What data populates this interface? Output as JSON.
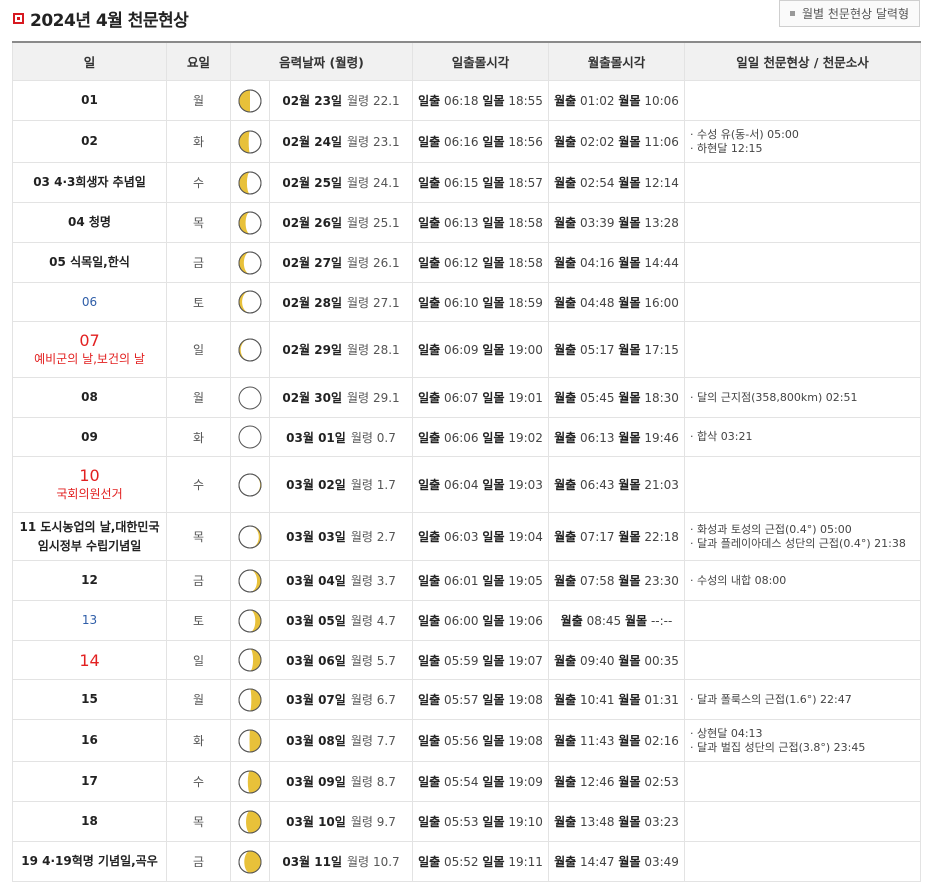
{
  "header": {
    "title": "2024년 4월 천문현상",
    "calendar_button": "월별 천문현상 달력형"
  },
  "columns": [
    "일",
    "요일",
    "음력날짜 (월령)",
    "일출몰시각",
    "월출몰시각",
    "일일 천문현상 / 천문소사"
  ],
  "labels": {
    "sunrise": "일출",
    "sunset": "일몰",
    "moonrise": "월출",
    "moonset": "월몰",
    "age": "월령"
  },
  "rows": [
    {
      "day": "01",
      "holiday": "",
      "style": "normal",
      "dow": "월",
      "lunar": "02월 23일",
      "age": "22.1",
      "sunrise": "06:18",
      "sunset": "18:55",
      "moonrise": "01:02",
      "moonset": "10:06",
      "events": [],
      "phase": 0.75
    },
    {
      "day": "02",
      "holiday": "",
      "style": "normal",
      "dow": "화",
      "lunar": "02월 24일",
      "age": "23.1",
      "sunrise": "06:16",
      "sunset": "18:56",
      "moonrise": "02:02",
      "moonset": "11:06",
      "events": [
        "수성 유(동-서) 05:00",
        "하현달 12:15"
      ],
      "phase": 0.78
    },
    {
      "day": "03",
      "holiday": "4·3희생자 추념일",
      "style": "inline",
      "dow": "수",
      "lunar": "02월 25일",
      "age": "24.1",
      "sunrise": "06:15",
      "sunset": "18:57",
      "moonrise": "02:54",
      "moonset": "12:14",
      "events": [],
      "phase": 0.82
    },
    {
      "day": "04",
      "holiday": "청명",
      "style": "inline",
      "dow": "목",
      "lunar": "02월 26일",
      "age": "25.1",
      "sunrise": "06:13",
      "sunset": "18:58",
      "moonrise": "03:39",
      "moonset": "13:28",
      "events": [],
      "phase": 0.85
    },
    {
      "day": "05",
      "holiday": "식목일,한식",
      "style": "inline",
      "dow": "금",
      "lunar": "02월 27일",
      "age": "26.1",
      "sunrise": "06:12",
      "sunset": "18:58",
      "moonrise": "04:16",
      "moonset": "14:44",
      "events": [],
      "phase": 0.89
    },
    {
      "day": "06",
      "holiday": "",
      "style": "blue",
      "dow": "토",
      "lunar": "02월 28일",
      "age": "27.1",
      "sunrise": "06:10",
      "sunset": "18:59",
      "moonrise": "04:48",
      "moonset": "16:00",
      "events": [],
      "phase": 0.93
    },
    {
      "day": "07",
      "holiday": "예비군의 날,보건의 날",
      "style": "red",
      "dow": "일",
      "lunar": "02월 29일",
      "age": "28.1",
      "sunrise": "06:09",
      "sunset": "19:00",
      "moonrise": "05:17",
      "moonset": "17:15",
      "events": [],
      "phase": 0.96
    },
    {
      "day": "08",
      "holiday": "",
      "style": "normal",
      "dow": "월",
      "lunar": "02월 30일",
      "age": "29.1",
      "sunrise": "06:07",
      "sunset": "19:01",
      "moonrise": "05:45",
      "moonset": "18:30",
      "events": [
        "달의 근지점(358,800km) 02:51"
      ],
      "phase": 0.99
    },
    {
      "day": "09",
      "holiday": "",
      "style": "normal",
      "dow": "화",
      "lunar": "03월 01일",
      "age": "0.7",
      "sunrise": "06:06",
      "sunset": "19:02",
      "moonrise": "06:13",
      "moonset": "19:46",
      "events": [
        "합삭 03:21"
      ],
      "phase": 0.0
    },
    {
      "day": "10",
      "holiday": "국회의원선거",
      "style": "red",
      "dow": "수",
      "lunar": "03월 02일",
      "age": "1.7",
      "sunrise": "06:04",
      "sunset": "19:03",
      "moonrise": "06:43",
      "moonset": "21:03",
      "events": [],
      "phase": 0.02
    },
    {
      "day": "11",
      "holiday": "도시농업의 날,대한민국 임시정부 수립기념일",
      "style": "inline2",
      "dow": "목",
      "lunar": "03월 03일",
      "age": "2.7",
      "sunrise": "06:03",
      "sunset": "19:04",
      "moonrise": "07:17",
      "moonset": "22:18",
      "events": [
        "화성과 토성의 근접(0.4°) 05:00",
        "달과 플레이아데스 성단의 근접(0.4°) 21:38"
      ],
      "phase": 0.05
    },
    {
      "day": "12",
      "holiday": "",
      "style": "normal",
      "dow": "금",
      "lunar": "03월 04일",
      "age": "3.7",
      "sunrise": "06:01",
      "sunset": "19:05",
      "moonrise": "07:58",
      "moonset": "23:30",
      "events": [
        "수성의 내합 08:00"
      ],
      "phase": 0.09
    },
    {
      "day": "13",
      "holiday": "",
      "style": "blue",
      "dow": "토",
      "lunar": "03월 05일",
      "age": "4.7",
      "sunrise": "06:00",
      "sunset": "19:06",
      "moonrise": "08:45",
      "moonset": "--:--",
      "events": [],
      "phase": 0.13
    },
    {
      "day": "14",
      "holiday": "",
      "style": "red",
      "dow": "일",
      "lunar": "03월 06일",
      "age": "5.7",
      "sunrise": "05:59",
      "sunset": "19:07",
      "moonrise": "09:40",
      "moonset": "00:35",
      "events": [],
      "phase": 0.18
    },
    {
      "day": "15",
      "holiday": "",
      "style": "normal",
      "dow": "월",
      "lunar": "03월 07일",
      "age": "6.7",
      "sunrise": "05:57",
      "sunset": "19:08",
      "moonrise": "10:41",
      "moonset": "01:31",
      "events": [
        "달과 폴룩스의 근접(1.6°) 22:47"
      ],
      "phase": 0.22
    },
    {
      "day": "16",
      "holiday": "",
      "style": "normal",
      "dow": "화",
      "lunar": "03월 08일",
      "age": "7.7",
      "sunrise": "05:56",
      "sunset": "19:08",
      "moonrise": "11:43",
      "moonset": "02:16",
      "events": [
        "상현달 04:13",
        "달과 벌집 성단의 근접(3.8°) 23:45"
      ],
      "phase": 0.26
    },
    {
      "day": "17",
      "holiday": "",
      "style": "normal",
      "dow": "수",
      "lunar": "03월 09일",
      "age": "8.7",
      "sunrise": "05:54",
      "sunset": "19:09",
      "moonrise": "12:46",
      "moonset": "02:53",
      "events": [],
      "phase": 0.3
    },
    {
      "day": "18",
      "holiday": "",
      "style": "normal",
      "dow": "목",
      "lunar": "03월 10일",
      "age": "9.7",
      "sunrise": "05:53",
      "sunset": "19:10",
      "moonrise": "13:48",
      "moonset": "03:23",
      "events": [],
      "phase": 0.34
    },
    {
      "day": "19",
      "holiday": "4·19혁명 기념일,곡우",
      "style": "inline",
      "dow": "금",
      "lunar": "03월 11일",
      "age": "10.7",
      "sunrise": "05:52",
      "sunset": "19:11",
      "moonrise": "14:47",
      "moonset": "03:49",
      "events": [],
      "phase": 0.38
    }
  ]
}
